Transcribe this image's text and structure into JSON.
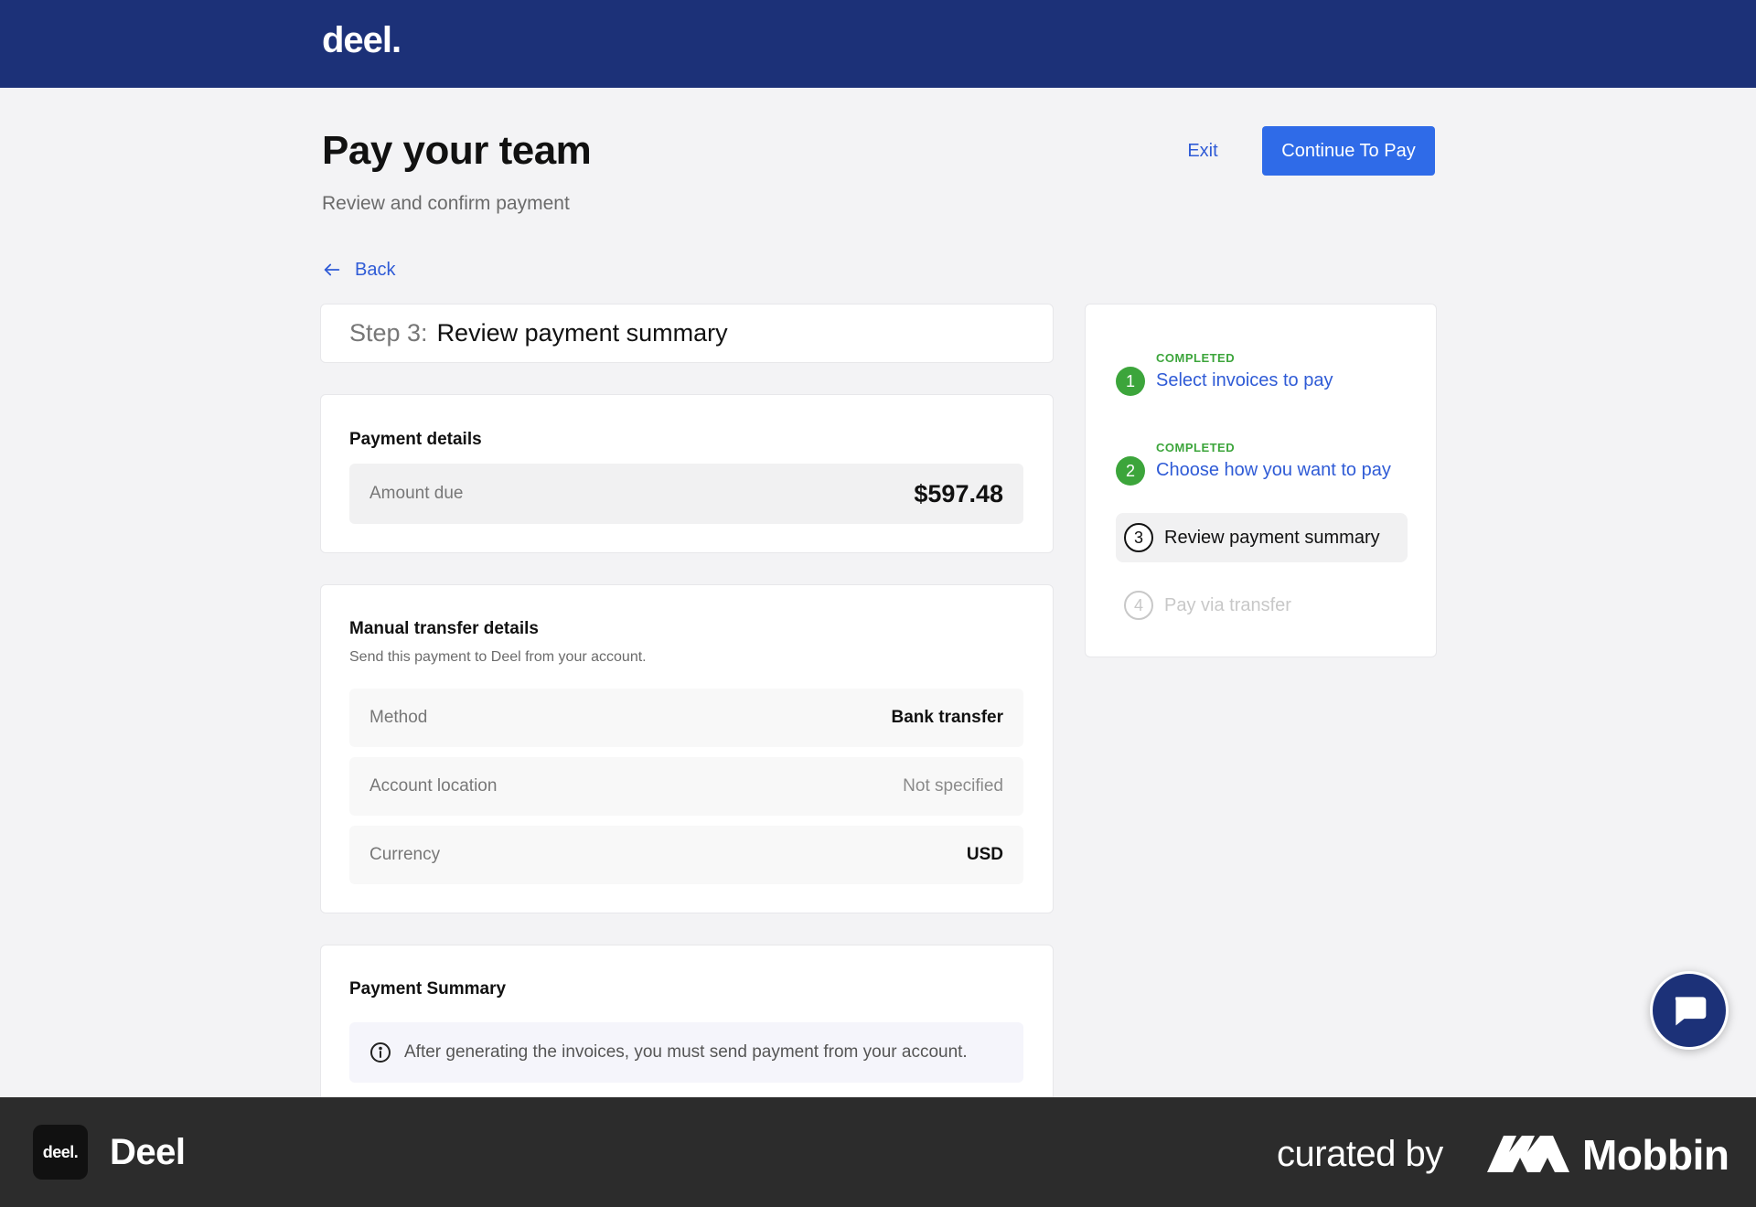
{
  "header": {
    "logo": "deel."
  },
  "page": {
    "title": "Pay your team",
    "subtitle": "Review and confirm payment",
    "exit_label": "Exit",
    "continue_label": "Continue To Pay",
    "back_label": "Back"
  },
  "step": {
    "prefix": "Step 3:",
    "title": "Review payment summary"
  },
  "payment_details": {
    "title": "Payment details",
    "amount_label": "Amount due",
    "amount_value": "$597.48"
  },
  "transfer_details": {
    "title": "Manual transfer details",
    "description": "Send this payment to Deel from your account.",
    "rows": [
      {
        "label": "Method",
        "value": "Bank transfer"
      },
      {
        "label": "Account location",
        "value": "Not specified"
      },
      {
        "label": "Currency",
        "value": "USD"
      }
    ]
  },
  "payment_summary": {
    "title": "Payment Summary",
    "info": "After generating the invoices, you must send payment from your account."
  },
  "stepper": [
    {
      "number": "1",
      "status": "COMPLETED",
      "label": "Select invoices to pay",
      "state": "done"
    },
    {
      "number": "2",
      "status": "COMPLETED",
      "label": "Choose how you want to pay",
      "state": "done"
    },
    {
      "number": "3",
      "status": "",
      "label": "Review payment summary",
      "state": "current"
    },
    {
      "number": "4",
      "status": "",
      "label": "Pay via transfer",
      "state": "future"
    }
  ],
  "footer": {
    "app_icon_text": "deel.",
    "app_name": "Deel",
    "curated_by": "curated by",
    "brand": "Mobbin"
  },
  "colors": {
    "header_bg": "#1c3178",
    "primary": "#2f6be8",
    "link": "#2f5bd6",
    "completed": "#3ca53b"
  },
  "icons": [
    "arrow-left-icon",
    "info-icon",
    "chat-icon",
    "mobbin-logo-icon"
  ]
}
